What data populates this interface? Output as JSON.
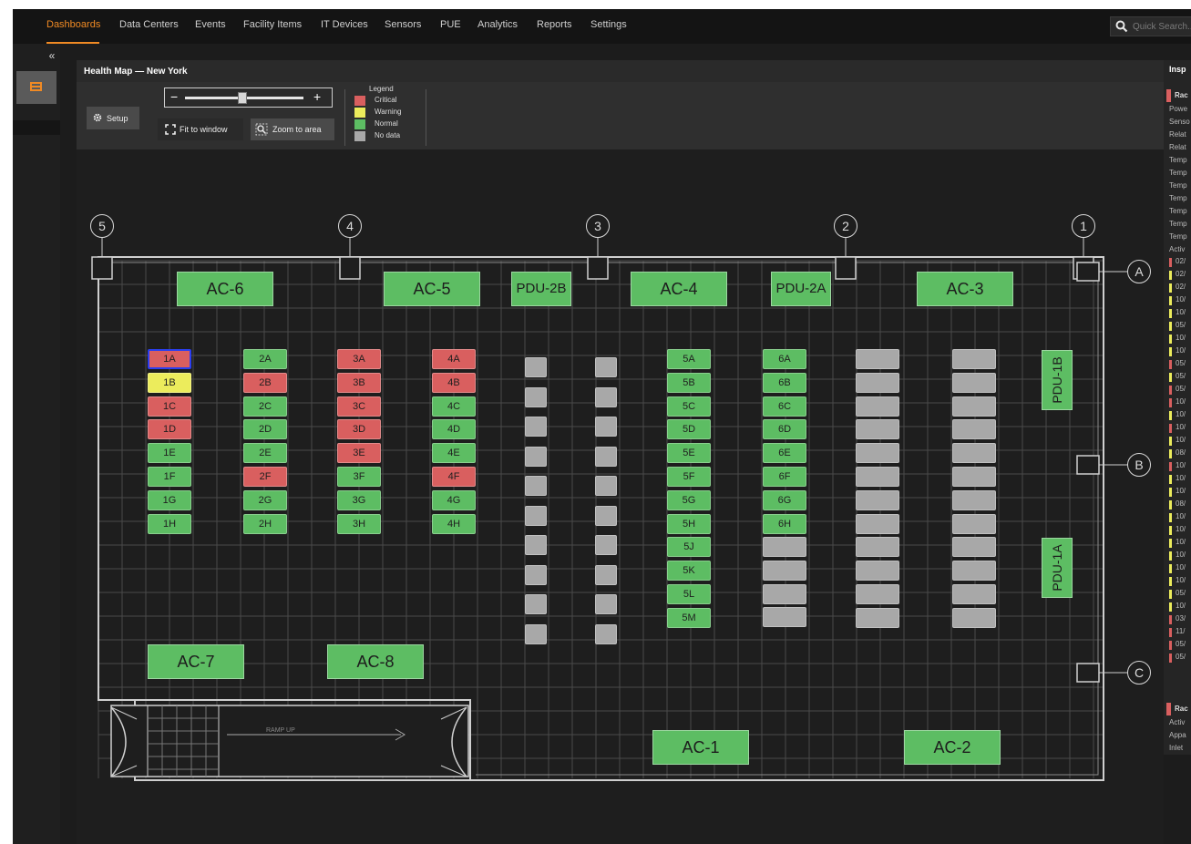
{
  "nav": {
    "items": [
      "Dashboards",
      "Data Centers",
      "Events",
      "Facility Items",
      "IT Devices",
      "Sensors",
      "PUE",
      "Analytics",
      "Reports",
      "Settings"
    ],
    "active": "Dashboards",
    "search_placeholder": "Quick Search..."
  },
  "sidebar": {
    "collapse_glyph": "«",
    "items": [
      {
        "icon": "dashboard-icon"
      }
    ]
  },
  "page": {
    "title": "Health Map — New York"
  },
  "toolbar": {
    "setup_label": "Setup",
    "fit_label": "Fit to window",
    "zoom_area_label": "Zoom to area",
    "zoom_level": 0.35
  },
  "legend": {
    "title": "Legend",
    "items": [
      {
        "label": "Critical",
        "color": "#d95f5f"
      },
      {
        "label": "Warning",
        "color": "#ecec5c"
      },
      {
        "label": "Normal",
        "color": "#5dbd63"
      },
      {
        "label": "No data",
        "color": "#a8a8a8"
      }
    ]
  },
  "status_colors": {
    "critical": "#d95f5f",
    "warning": "#ecec5c",
    "normal": "#5dbd63",
    "nodata": "#a8a8a8",
    "selected": "#2b3ff0"
  },
  "floor": {
    "columns": [
      "5",
      "4",
      "3",
      "2",
      "1"
    ],
    "rows": [
      "A",
      "B",
      "C"
    ],
    "units": [
      "AC-6",
      "AC-5",
      "PDU-2B",
      "AC-4",
      "PDU-2A",
      "AC-3",
      "AC-7",
      "AC-8",
      "AC-1",
      "AC-2",
      "PDU-1B",
      "PDU-1A"
    ],
    "ramp_label": "RAMP UP",
    "racks": [
      {
        "name": "1A",
        "status": "critical",
        "selected": true
      },
      {
        "name": "1B",
        "status": "warning"
      },
      {
        "name": "1C",
        "status": "critical"
      },
      {
        "name": "1D",
        "status": "critical"
      },
      {
        "name": "1E",
        "status": "normal"
      },
      {
        "name": "1F",
        "status": "normal"
      },
      {
        "name": "1G",
        "status": "normal"
      },
      {
        "name": "1H",
        "status": "normal"
      },
      {
        "name": "2A",
        "status": "normal"
      },
      {
        "name": "2B",
        "status": "critical"
      },
      {
        "name": "2C",
        "status": "normal"
      },
      {
        "name": "2D",
        "status": "normal"
      },
      {
        "name": "2E",
        "status": "normal"
      },
      {
        "name": "2F",
        "status": "critical"
      },
      {
        "name": "2G",
        "status": "normal"
      },
      {
        "name": "2H",
        "status": "normal"
      },
      {
        "name": "3A",
        "status": "critical"
      },
      {
        "name": "3B",
        "status": "critical"
      },
      {
        "name": "3C",
        "status": "critical"
      },
      {
        "name": "3D",
        "status": "critical"
      },
      {
        "name": "3E",
        "status": "critical"
      },
      {
        "name": "3F",
        "status": "normal"
      },
      {
        "name": "3G",
        "status": "normal"
      },
      {
        "name": "3H",
        "status": "normal"
      },
      {
        "name": "4A",
        "status": "critical"
      },
      {
        "name": "4B",
        "status": "critical"
      },
      {
        "name": "4C",
        "status": "normal"
      },
      {
        "name": "4D",
        "status": "normal"
      },
      {
        "name": "4E",
        "status": "normal"
      },
      {
        "name": "4F",
        "status": "critical"
      },
      {
        "name": "4G",
        "status": "normal"
      },
      {
        "name": "4H",
        "status": "normal"
      },
      {
        "name": "5A",
        "status": "normal"
      },
      {
        "name": "5B",
        "status": "normal"
      },
      {
        "name": "5C",
        "status": "normal"
      },
      {
        "name": "5D",
        "status": "normal"
      },
      {
        "name": "5E",
        "status": "normal"
      },
      {
        "name": "5F",
        "status": "normal"
      },
      {
        "name": "5G",
        "status": "normal"
      },
      {
        "name": "5H",
        "status": "normal"
      },
      {
        "name": "5J",
        "status": "normal"
      },
      {
        "name": "5K",
        "status": "normal"
      },
      {
        "name": "5L",
        "status": "normal"
      },
      {
        "name": "5M",
        "status": "normal"
      },
      {
        "name": "6A",
        "status": "normal"
      },
      {
        "name": "6B",
        "status": "normal"
      },
      {
        "name": "6C",
        "status": "normal"
      },
      {
        "name": "6D",
        "status": "normal"
      },
      {
        "name": "6E",
        "status": "normal"
      },
      {
        "name": "6F",
        "status": "normal"
      },
      {
        "name": "6G",
        "status": "normal"
      },
      {
        "name": "6H",
        "status": "normal"
      }
    ],
    "nodata_racks": {
      "row6_count": 4,
      "row7_count": 12,
      "row8_count": 12,
      "small_col_count": 10
    }
  },
  "inspector": {
    "title": "Insp",
    "section1": "Rac",
    "lines": [
      "Powe",
      "Senso",
      "Relat",
      "Relat",
      "Temp",
      "Temp",
      "Temp",
      "Temp",
      "Temp",
      "Temp",
      "Temp",
      "Activ"
    ],
    "rows": [
      {
        "text": "02/",
        "status": "critical"
      },
      {
        "text": "02/",
        "status": "warning"
      },
      {
        "text": "02/",
        "status": "warning"
      },
      {
        "text": "10/",
        "status": "warning"
      },
      {
        "text": "10/",
        "status": "warning"
      },
      {
        "text": "05/",
        "status": "warning"
      },
      {
        "text": "10/",
        "status": "warning"
      },
      {
        "text": "10/",
        "status": "warning"
      },
      {
        "text": "05/",
        "status": "critical"
      },
      {
        "text": "05/",
        "status": "warning"
      },
      {
        "text": "05/",
        "status": "critical"
      },
      {
        "text": "10/",
        "status": "critical"
      },
      {
        "text": "10/",
        "status": "warning"
      },
      {
        "text": "10/",
        "status": "critical"
      },
      {
        "text": "10/",
        "status": "warning"
      },
      {
        "text": "08/",
        "status": "warning"
      },
      {
        "text": "10/",
        "status": "critical"
      },
      {
        "text": "10/",
        "status": "warning"
      },
      {
        "text": "10/",
        "status": "warning"
      },
      {
        "text": "08/",
        "status": "warning"
      },
      {
        "text": "10/",
        "status": "warning"
      },
      {
        "text": "10/",
        "status": "warning"
      },
      {
        "text": "10/",
        "status": "warning"
      },
      {
        "text": "10/",
        "status": "warning"
      },
      {
        "text": "10/",
        "status": "warning"
      },
      {
        "text": "10/",
        "status": "warning"
      },
      {
        "text": "05/",
        "status": "warning"
      },
      {
        "text": "10/",
        "status": "warning"
      },
      {
        "text": "03/",
        "status": "critical"
      },
      {
        "text": "11/",
        "status": "critical"
      },
      {
        "text": "05/",
        "status": "critical"
      },
      {
        "text": "05/",
        "status": "critical"
      }
    ],
    "section2": "Rac",
    "lines2": [
      "Activ",
      "Appa",
      "Inlet"
    ]
  }
}
